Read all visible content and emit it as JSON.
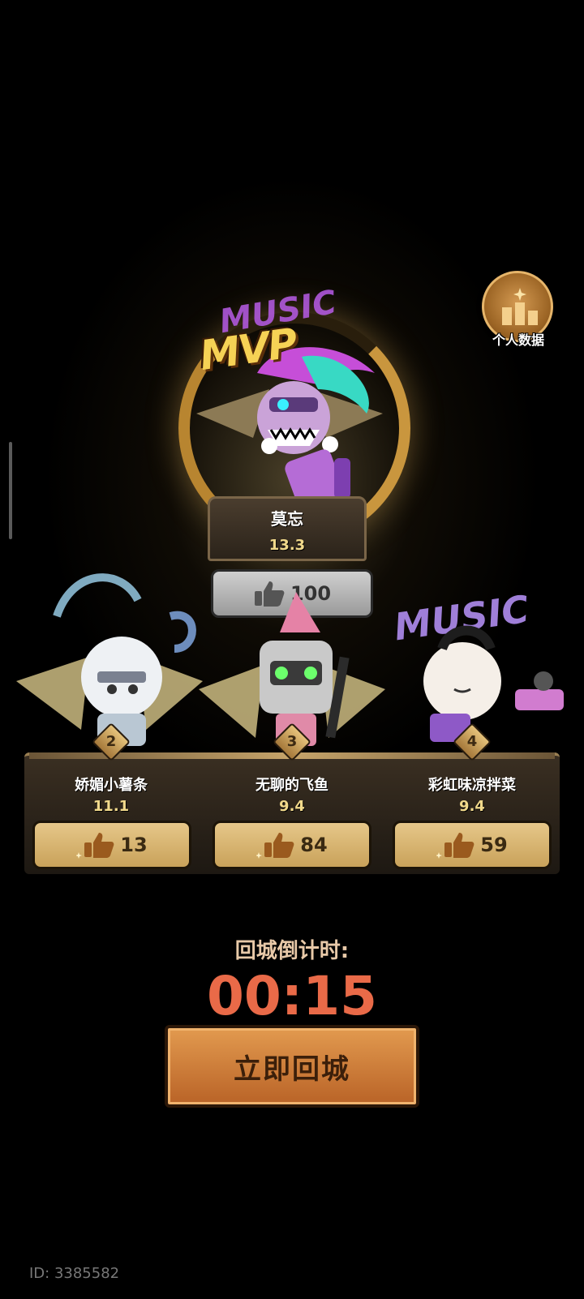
{
  "personal": {
    "label": "个人数据",
    "icon": "bar-chart-icon"
  },
  "mvp": {
    "badge": "MVP",
    "graffiti": "MUSIC",
    "name": "莫忘",
    "score": "13.3",
    "likes": "100"
  },
  "players": [
    {
      "rank": "2",
      "name": "娇媚小薯条",
      "score": "11.1",
      "likes": "13",
      "graffiti": ""
    },
    {
      "rank": "3",
      "name": "无聊的飞鱼",
      "score": "9.4",
      "likes": "84",
      "graffiti": ""
    },
    {
      "rank": "4",
      "name": "彩虹味凉拌菜",
      "score": "9.4",
      "likes": "59",
      "graffiti": "MUSIC"
    }
  ],
  "countdown": {
    "label": "回城倒计时:",
    "time": "00:15"
  },
  "return_button": "立即回城",
  "footer_id": "ID: 3385582",
  "colors": {
    "accent_gold": "#e6c789",
    "countdown_red": "#e96a48",
    "button_orange": "#d4803d"
  }
}
